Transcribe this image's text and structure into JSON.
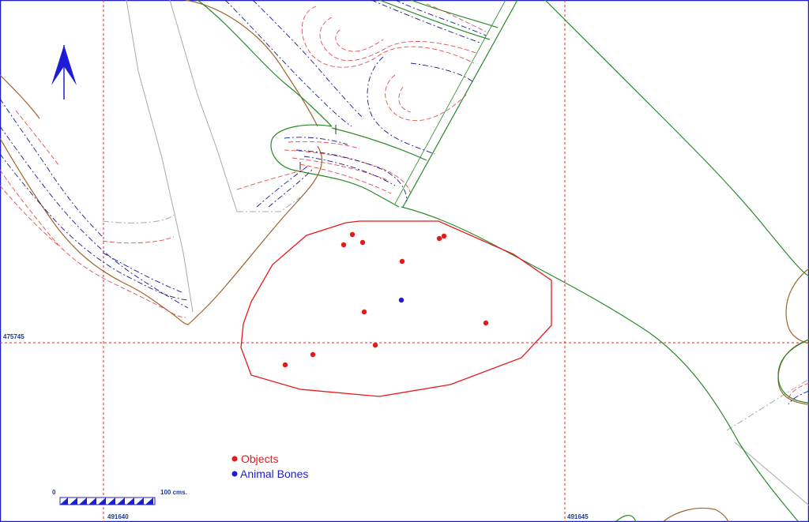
{
  "legend": {
    "objects_label": "Objects",
    "bones_label": "Animal Bones",
    "objects_color": "#e8191b",
    "bones_color": "#1d1dd8"
  },
  "grid": {
    "y_label": "475745",
    "x_label_left": "491640",
    "x_label_right": "491645"
  },
  "scale": {
    "start_label": "0",
    "end_label": "100 cms."
  },
  "icons": {
    "north_arrow": "north-arrow-icon"
  },
  "colors": {
    "grid": "#c83232",
    "contour_red": "#e05050",
    "contour_blue": "#1a1a8a",
    "green_line": "#2a8a2a",
    "brown_line": "#a0642a",
    "gray_line": "#aaaaaa",
    "frame": "#2020c0"
  }
}
